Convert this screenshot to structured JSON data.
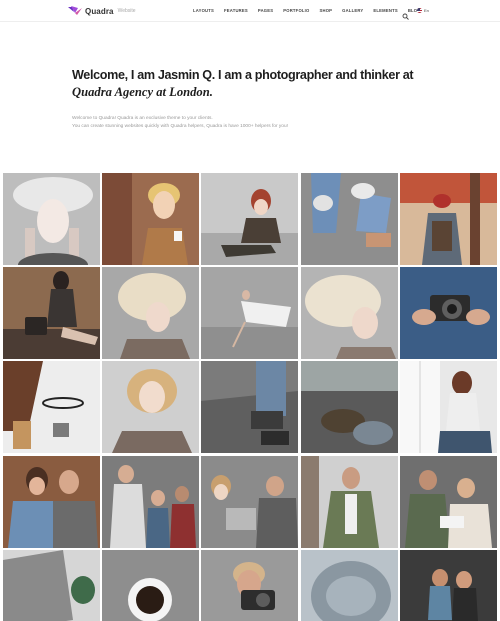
{
  "header": {
    "logo": {
      "name": "Quadra",
      "sub": "Website"
    },
    "nav": [
      "LAYOUTS",
      "FEATURES",
      "PAGES",
      "PORTFOLIO",
      "SHOP",
      "GALLERY",
      "ELEMENTS",
      "BLOG"
    ],
    "search_icon": "search-icon",
    "language": "En"
  },
  "intro": {
    "headline_part1": "Welcome, I am Jasmin Q. I am a photographer and thinker at ",
    "headline_part2": "Quadra Agency at London.",
    "lead_line1": "Welcome to Quadra! Quadra is an exclusive theme to your clients.",
    "lead_line2": "You can create stunning websites quickly with Quadra helpers, Quadra is have 1000+ helpers for you!"
  },
  "gallery": {
    "photos": [
      "woman-with-veil-hat",
      "woman-with-cup",
      "woman-sitting-floor",
      "sneakers-on-pavement",
      "hiker-with-backpack",
      "woman-with-handbag",
      "woman-curly-blonde-hair",
      "dancer-in-white-dress",
      "woman-hair-in-wind",
      "hands-holding-camera",
      "camera-and-glasses",
      "woman-blonde-portrait",
      "boots-on-fence",
      "cap-on-car-seat",
      "woman-by-window",
      "couple-laughing",
      "friends-group",
      "woman-with-laptop",
      "man-with-jacket",
      "couple-with-book",
      "woman-grey-sweater",
      "coffee-cup-topdown",
      "man-with-camera",
      "grey-hair-closeup",
      "couple-workout"
    ],
    "palette": {
      "neutral": "#d0d0d0",
      "warm": "#c9a07a",
      "cool": "#7f95ab"
    }
  }
}
